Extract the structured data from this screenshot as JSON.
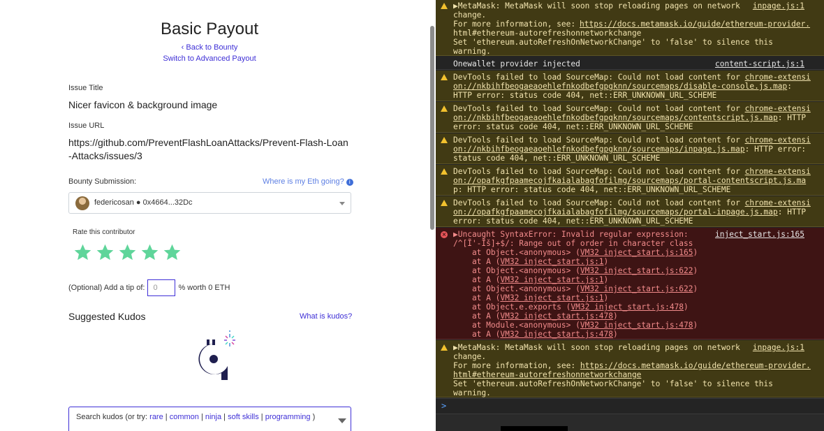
{
  "page": {
    "title": "Basic Payout",
    "back_link": "‹ Back to Bounty",
    "switch_link": "Switch to Advanced Payout",
    "issue_title_label": "Issue Title",
    "issue_title": "Nicer favicon & background image",
    "issue_url_label": "Issue URL",
    "issue_url": "https://github.com/PreventFlashLoanAttacks/Prevent-Flash-Loan-Attacks/issues/3",
    "bounty_submission_label": "Bounty Submission:",
    "eth_link": "Where is my Eth going?",
    "info_icon": "i",
    "submission_user": "federicosan ● 0x4664...32Dc",
    "rate_label": "Rate this contributor",
    "rating": 5,
    "rating_max": 5,
    "tip_label": "(Optional) Add a tip of:",
    "tip_value": "0",
    "tip_suffix": "% worth 0 ETH",
    "suggested_kudos": "Suggested Kudos",
    "what_is_kudos": "What is kudos?",
    "search_prefix": "Search kudos (or try: ",
    "search_kw": [
      "rare",
      "common",
      "ninja",
      "soft skills",
      "programming"
    ],
    "search_sep": " | ",
    "search_suffix": " )"
  },
  "console": {
    "m1": {
      "text": "▶MetaMask: MetaMask will soon stop reloading pages on network\nchange.\nFor more information, see: \nhtml#ethereum-autorefreshonnetworkchange\nSet 'ethereum.autoRefreshOnNetworkChange' to 'false' to silence this\nwarning.",
      "link": "https://docs.metamask.io/guide/ethereum-provider.",
      "src": "inpage.js:1"
    },
    "m2": {
      "text": "Onewallet provider injected",
      "src": "content-script.js:1"
    },
    "m3": {
      "pre": "DevTools failed to load SourceMap: Could not load content for ",
      "link1": "chrome-extensi",
      "link2": "on://nkbihfbeogaeaoehlefnkodbefgpgknn/sourcemaps/disable-console.js.map",
      "post": ":\nHTTP error: status code 404, net::ERR_UNKNOWN_URL_SCHEME"
    },
    "m4": {
      "pre": "DevTools failed to load SourceMap: Could not load content for ",
      "link1": "chrome-extensi",
      "link2": "on://nkbihfbeogaeaoehlefnkodbefgpgknn/sourcemaps/contentscript.js.map",
      "post": ": HTTP\nerror: status code 404, net::ERR_UNKNOWN_URL_SCHEME"
    },
    "m5": {
      "pre": "DevTools failed to load SourceMap: Could not load content for ",
      "link1": "chrome-extensi",
      "link2": "on://nkbihfbeogaeaoehlefnkodbefgpgknn/sourcemaps/inpage.js.map",
      "post": ": HTTP error:\nstatus code 404, net::ERR_UNKNOWN_URL_SCHEME"
    },
    "m6": {
      "pre": "DevTools failed to load SourceMap: Could not load content for ",
      "link1": "chrome-extensi",
      "link2": "on://opafkgfpaamecojfkaialabagfofilmg/sourcemaps/portal-contentscript.js.ma",
      "post": "\np: HTTP error: status code 404, net::ERR_UNKNOWN_URL_SCHEME"
    },
    "m7": {
      "pre": "DevTools failed to load SourceMap: Could not load content for ",
      "link1": "chrome-extensi",
      "link2": "on://opafkgfpaamecojfkaialabagfofilmg/sourcemaps/portal-inpage.js.map",
      "post": ": HTTP\nerror: status code 404, net::ERR_UNKNOWN_URL_SCHEME"
    },
    "m8": {
      "head": "▶Uncaught SyntaxError: Invalid regular expression:\n/^[Ĩ'-Ĩš]+$/: Range out of order in character class",
      "src": "inject_start.js:165",
      "stack": [
        {
          "fn": "    at Object.<anonymous> (",
          "link": "VM32 inject_start.js:165",
          "end": ")"
        },
        {
          "fn": "    at A (",
          "link": "VM32 inject_start.js:1",
          "end": ")"
        },
        {
          "fn": "    at Object.<anonymous> (",
          "link": "VM32 inject_start.js:622",
          "end": ")"
        },
        {
          "fn": "    at A (",
          "link": "VM32 inject_start.js:1",
          "end": ")"
        },
        {
          "fn": "    at Object.<anonymous> (",
          "link": "VM32 inject_start.js:622",
          "end": ")"
        },
        {
          "fn": "    at A (",
          "link": "VM32 inject_start.js:1",
          "end": ")"
        },
        {
          "fn": "    at Object.e.exports (",
          "link": "VM32 inject_start.js:478",
          "end": ")"
        },
        {
          "fn": "    at A (",
          "link": "VM32 inject_start.js:478",
          "end": ")"
        },
        {
          "fn": "    at Module.<anonymous> (",
          "link": "VM32 inject_start.js:478",
          "end": ")"
        },
        {
          "fn": "    at A (",
          "link": "VM32 inject_start.js:478",
          "end": ")"
        }
      ]
    },
    "m9": {
      "head": "▶MetaMask: MetaMask will soon stop reloading pages on network\nchange.\nFor more information, see: ",
      "link1": "https://docs.metamask.io/guide/ethereum-provider.",
      "link2": "html#ethereum-autorefreshonnetworkchange",
      "tail": "\nSet 'ethereum.autoRefreshOnNetworkChange' to 'false' to silence this\nwarning.",
      "src": "inpage.js:1"
    },
    "prompt": ">"
  },
  "colors": {
    "star": "#5fd59a",
    "link": "#3e2fd6",
    "warning": "#f2c12e",
    "error": "#e9565a",
    "kudos_logo": "#1f1f4f"
  }
}
